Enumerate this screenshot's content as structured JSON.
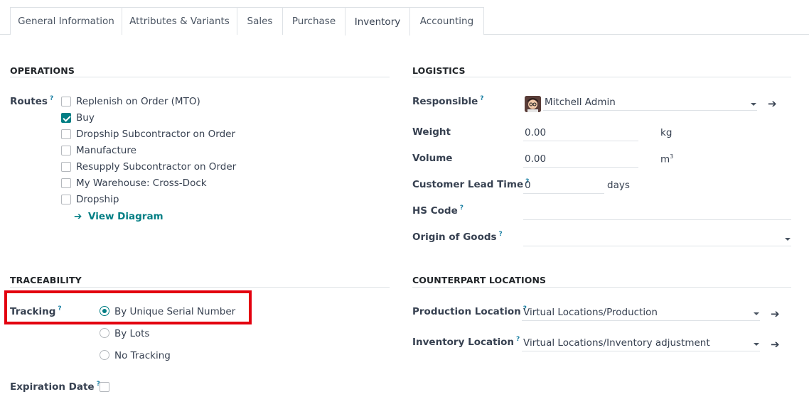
{
  "tabs": [
    "General Information",
    "Attributes & Variants",
    "Sales",
    "Purchase",
    "Inventory",
    "Accounting"
  ],
  "active_tab": "Inventory",
  "operations": {
    "title": "OPERATIONS",
    "routes_label": "Routes",
    "routes": [
      {
        "label": "Replenish on Order (MTO)",
        "checked": false
      },
      {
        "label": "Buy",
        "checked": true
      },
      {
        "label": "Dropship Subcontractor on Order",
        "checked": false
      },
      {
        "label": "Manufacture",
        "checked": false
      },
      {
        "label": "Resupply Subcontractor on Order",
        "checked": false
      },
      {
        "label": "My Warehouse: Cross-Dock",
        "checked": false
      },
      {
        "label": "Dropship",
        "checked": false
      }
    ],
    "view_diagram": "View Diagram"
  },
  "logistics": {
    "title": "LOGISTICS",
    "responsible_label": "Responsible",
    "responsible_value": "Mitchell Admin",
    "weight_label": "Weight",
    "weight_value": "0.00",
    "weight_unit": "kg",
    "volume_label": "Volume",
    "volume_value": "0.00",
    "volume_unit": "m",
    "volume_unit_sup": "3",
    "lead_time_label": "Customer Lead Time",
    "lead_time_value": "0",
    "lead_time_unit": "days",
    "hs_code_label": "HS Code",
    "hs_code_value": "",
    "origin_label": "Origin of Goods",
    "origin_value": ""
  },
  "traceability": {
    "title": "TRACEABILITY",
    "tracking_label": "Tracking",
    "options": [
      {
        "label": "By Unique Serial Number",
        "selected": true
      },
      {
        "label": "By Lots",
        "selected": false
      },
      {
        "label": "No Tracking",
        "selected": false
      }
    ],
    "expiration_label": "Expiration Date",
    "expiration_checked": false
  },
  "counterpart": {
    "title": "COUNTERPART LOCATIONS",
    "production_label": "Production Location",
    "production_value": "Virtual Locations/Production",
    "inventory_label": "Inventory Location",
    "inventory_value": "Virtual Locations/Inventory adjustment"
  },
  "help_mark": "?",
  "colors": {
    "accent": "#017e84",
    "highlight": "#e3000f",
    "help": "#1a7fa3"
  }
}
